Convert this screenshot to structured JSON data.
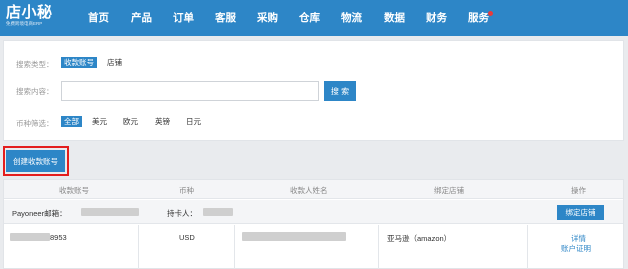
{
  "header": {
    "logo_text": "店小秘",
    "logo_subtext": "免费跨境电商ERP",
    "nav": [
      "首页",
      "产品",
      "订单",
      "客服",
      "采购",
      "仓库",
      "物流",
      "数据",
      "财务",
      "服务"
    ]
  },
  "filters": {
    "type_label": "搜索类型：",
    "type_options": [
      "收款账号",
      "店铺"
    ],
    "type_selected": "收款账号",
    "content_label": "搜索内容：",
    "search_value": "",
    "search_button": "搜 索",
    "currency_label": "币种筛选：",
    "currency_options": [
      "全部",
      "美元",
      "欧元",
      "英镑",
      "日元"
    ],
    "currency_selected": "全部"
  },
  "create_button": "创建收款账号",
  "table": {
    "columns": [
      "收款账号",
      "币种",
      "收款人姓名",
      "绑定店铺",
      "操作"
    ],
    "group": {
      "payoneer_label": "Payoneer邮箱：",
      "holder_label": "持卡人：",
      "bind_button": "绑定店铺"
    },
    "row": {
      "account_suffix": "8953",
      "currency": "USD",
      "shop": "亚马逊（amazon）",
      "actions": [
        "详情",
        "账户证明"
      ]
    }
  },
  "colors": {
    "brand": "#2d86c7",
    "highlight_border": "#e31d1d",
    "notice_dot": "#e93a3a"
  }
}
